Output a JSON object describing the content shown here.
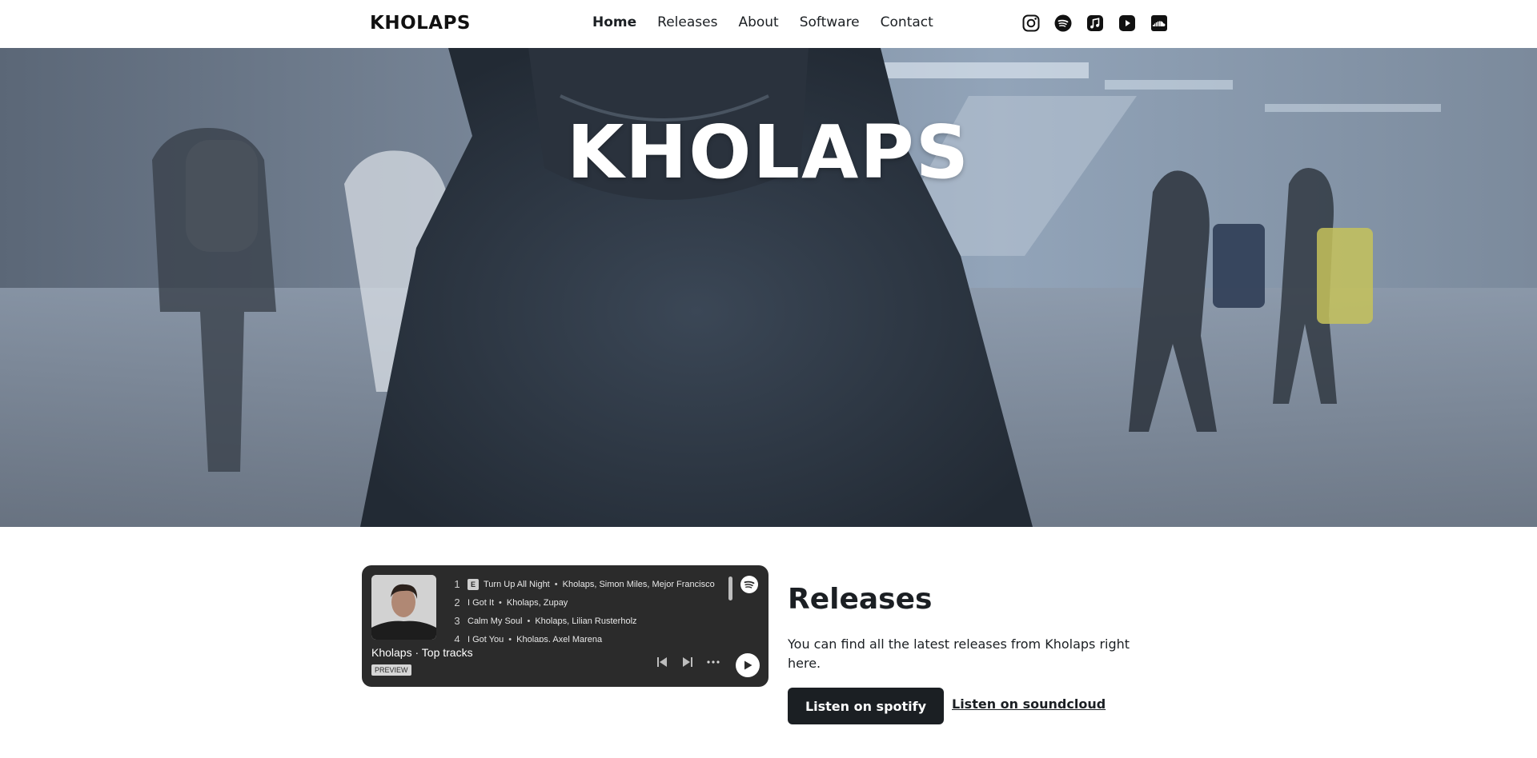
{
  "header": {
    "logo": "KHOLAPS",
    "nav": [
      {
        "label": "Home",
        "active": true
      },
      {
        "label": "Releases",
        "active": false
      },
      {
        "label": "About",
        "active": false
      },
      {
        "label": "Software",
        "active": false
      },
      {
        "label": "Contact",
        "active": false
      }
    ],
    "socials": [
      "instagram-icon",
      "spotify-icon",
      "apple-music-icon",
      "youtube-icon",
      "soundcloud-icon"
    ]
  },
  "hero": {
    "title": "KHOLAPS"
  },
  "player": {
    "tracks": [
      {
        "num": "1",
        "explicit": "E",
        "title": "Turn Up All Night",
        "artists": "Kholaps, Simon Miles, Mejor Francisco"
      },
      {
        "num": "2",
        "title": "I Got It",
        "artists": "Kholaps, Zupay"
      },
      {
        "num": "3",
        "title": "Calm My Soul",
        "artists": "Kholaps, Lilian Rusterholz"
      },
      {
        "num": "4",
        "title": "I Got You",
        "artists": "Kholaps, Axel Marena"
      }
    ],
    "title": "Kholaps · Top tracks",
    "badge": "PREVIEW"
  },
  "releases": {
    "heading": "Releases",
    "text": "You can find all the latest releases from Kholaps right here.",
    "spotify_button": "Listen on spotify",
    "soundcloud_link": "Listen on soundcloud"
  },
  "colors": {
    "primary": "#1b1f23",
    "player_bg": "#2b2b2b",
    "white": "#ffffff"
  }
}
